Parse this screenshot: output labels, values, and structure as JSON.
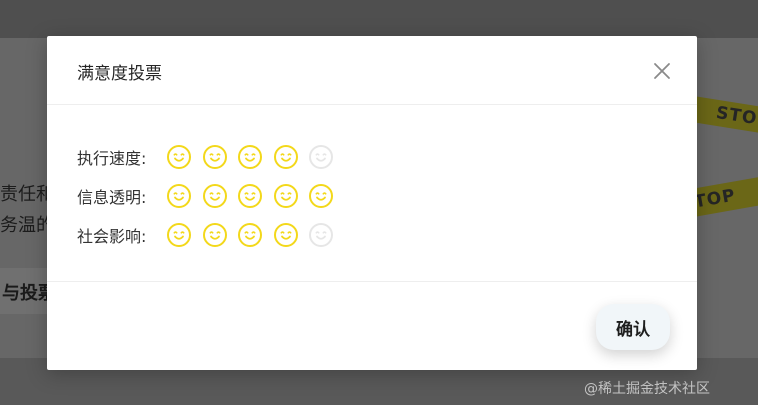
{
  "background": {
    "text_line_1": "责任和",
    "text_line_2": "务温的",
    "vote_strip_text": "与投票",
    "tape_1_text": "STO",
    "tape_2_text": "TOP",
    "watermark": "@稀土掘金技术社区",
    "tape_color": "#d4c82a",
    "overlay_color": "#5a5a5a"
  },
  "modal": {
    "title": "满意度投票",
    "close_icon": "close-icon",
    "ratings": [
      {
        "label": "执行速度:",
        "score": 4,
        "max": 5
      },
      {
        "label": "信息透明:",
        "score": 5,
        "max": 5
      },
      {
        "label": "社会影响:",
        "score": 4,
        "max": 5
      }
    ],
    "face_icon": "smiley-face-icon",
    "active_color": "#f3d81a",
    "inactive_color": "#e6e6e6",
    "confirm_label": "确认"
  }
}
